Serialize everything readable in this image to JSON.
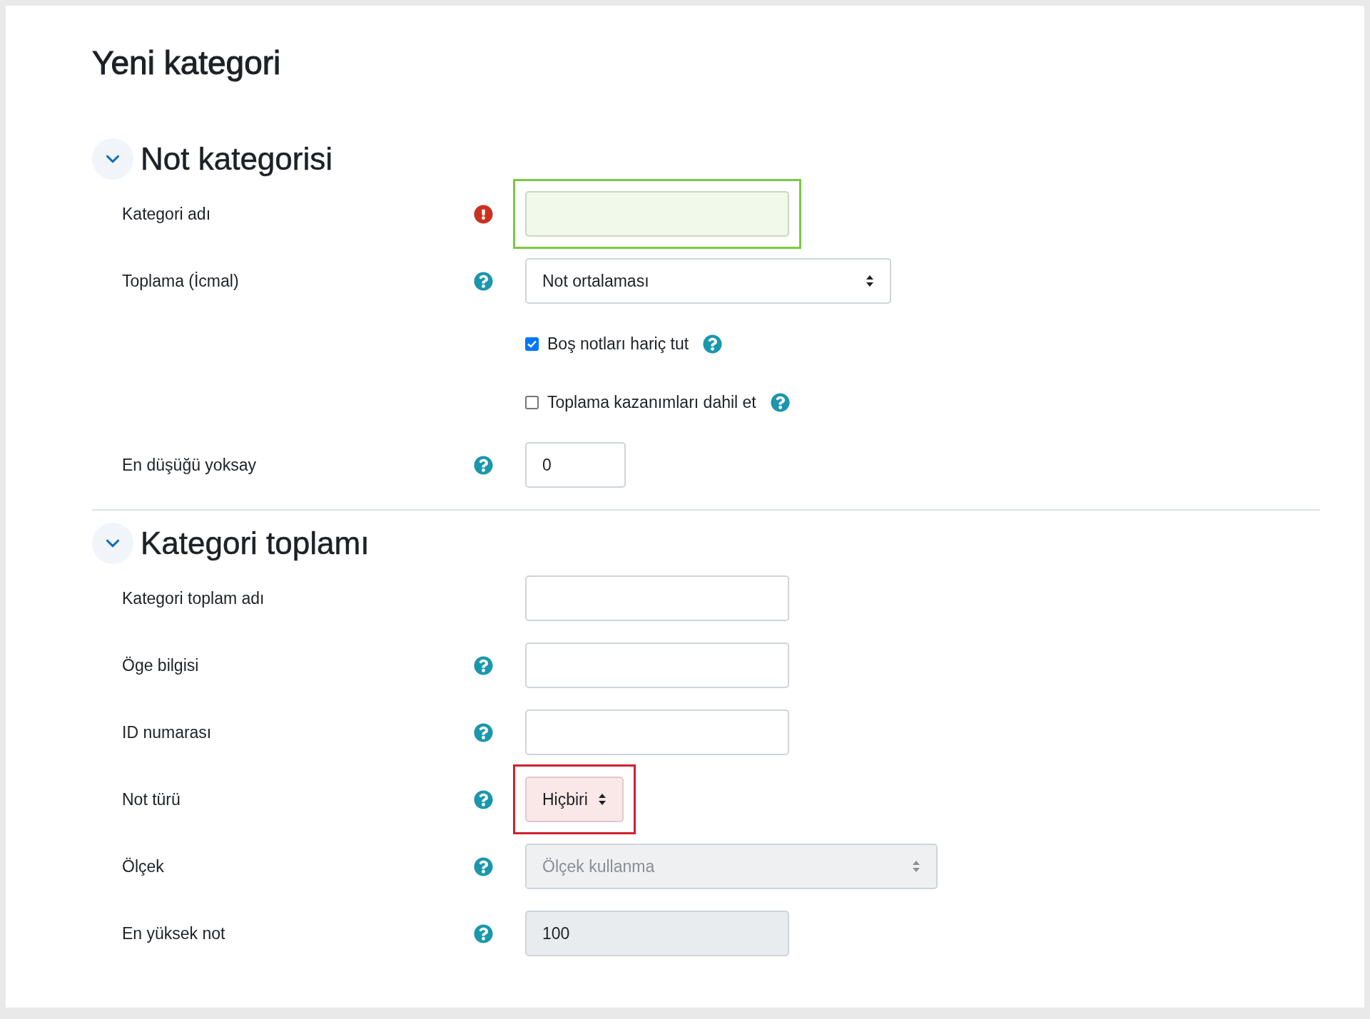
{
  "page_title": "Yeni kategori",
  "sections": [
    {
      "title": "Not kategorisi",
      "expanded": true,
      "rows": [
        {
          "kind": "text",
          "label": "Kategori adı",
          "required": true,
          "help": false,
          "disabled": false,
          "color": "#7ac943"
        },
        {
          "kind": "select",
          "label": "Toplama (İcmal)",
          "required": false,
          "help": true,
          "disabled": false,
          "value": "Not ortalaması"
        },
        {
          "kind": "checkbox",
          "label": "Boş notları hariç tut",
          "required": false,
          "help": true,
          "disabled": false,
          "checked": true
        },
        {
          "kind": "checkbox",
          "label": "Toplama kazanımları dahil et",
          "required": false,
          "help": true,
          "disabled": false,
          "checked": false
        },
        {
          "kind": "text",
          "label": "En düşüğü yoksay",
          "required": false,
          "help": true,
          "disabled": false,
          "value": "0"
        }
      ]
    },
    {
      "title": "Kategori toplamı",
      "expanded": true,
      "rows": [
        {
          "kind": "text",
          "label": "Kategori toplam adı",
          "required": false,
          "help": false,
          "disabled": false
        },
        {
          "kind": "text",
          "label": "Öge bilgisi",
          "required": false,
          "help": true,
          "disabled": false
        },
        {
          "kind": "text",
          "label": "ID numarası",
          "required": false,
          "help": true,
          "disabled": false
        },
        {
          "kind": "select",
          "label": "Not türü",
          "required": false,
          "help": true,
          "disabled": false,
          "value": "Hiçbiri",
          "color": "#d0202f"
        },
        {
          "kind": "select",
          "label": "Ölçek",
          "required": false,
          "help": true,
          "disabled": true,
          "value": "Ölçek kullanma"
        },
        {
          "kind": "text",
          "label": "En yüksek not",
          "required": false,
          "help": true,
          "disabled": true,
          "value": "100"
        }
      ]
    }
  ]
}
